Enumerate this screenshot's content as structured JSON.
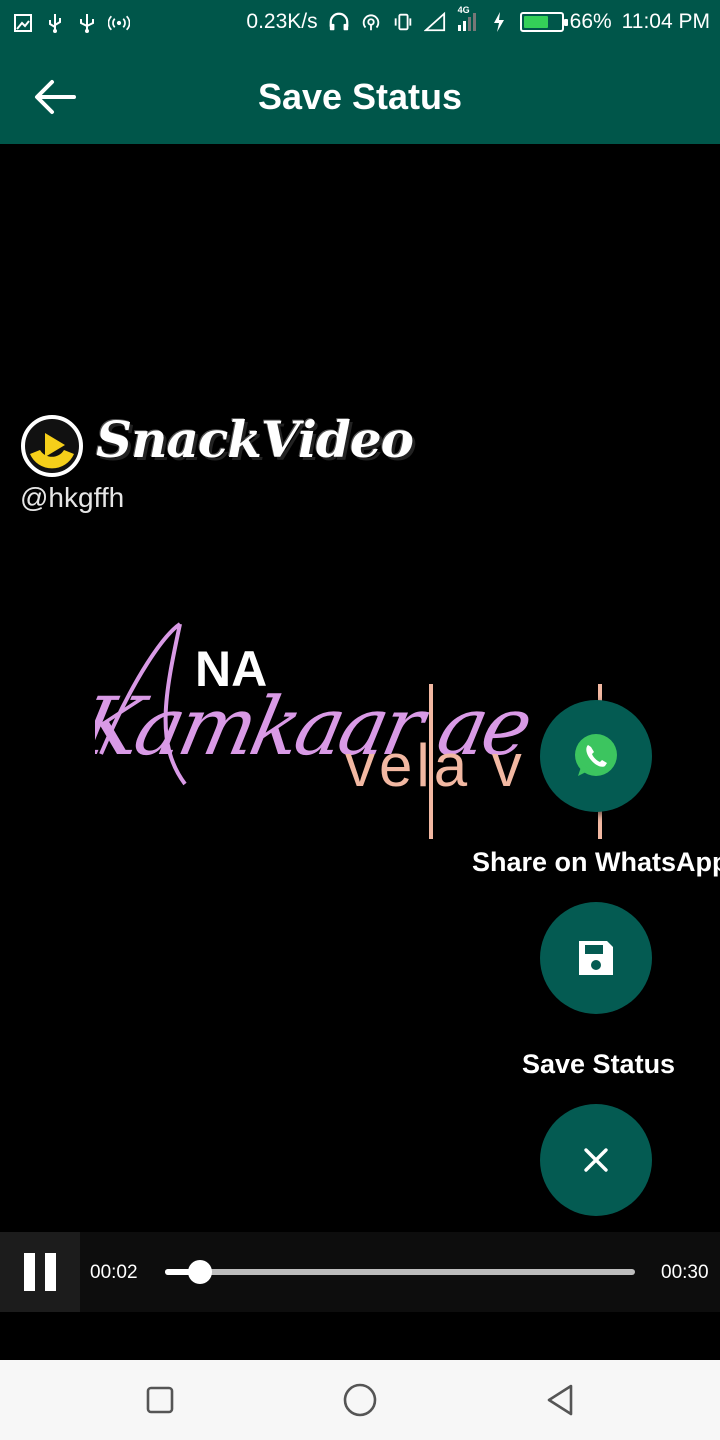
{
  "status_bar": {
    "net_speed": "0.23K/s",
    "network_type": "4G",
    "battery_percent": "66%",
    "battery_level": 0.66,
    "time": "11:04 PM",
    "icons": [
      "screenshot-icon",
      "usb-icon",
      "usb-icon",
      "hotspot-icon",
      "headphones-icon",
      "wifi-hotspot-icon",
      "vibrate-icon",
      "signal-icon",
      "signal-icon",
      "charging-icon",
      "battery-icon"
    ]
  },
  "app_bar": {
    "title": "Save Status",
    "back_icon": "arrow-left-icon"
  },
  "video": {
    "watermark_brand": "SnackVideo",
    "watermark_user": "@hkgffh",
    "lyric_line1": "NA",
    "lyric_line2": "Kamkaar ae",
    "lyric_line3": "vela v"
  },
  "fab_menu": {
    "share_label": "Share on WhatsApp",
    "save_label": "Save Status",
    "share_icon": "whatsapp-icon",
    "save_icon": "floppy-disk-icon",
    "close_icon": "close-icon",
    "accent": "#045b52"
  },
  "player": {
    "current_time": "00:02",
    "duration": "00:30",
    "progress": 0.074
  },
  "colors": {
    "app_bar": "#00564a",
    "lyric_pink": "#d99ae6",
    "lyric_peach": "#f2b8a2"
  }
}
